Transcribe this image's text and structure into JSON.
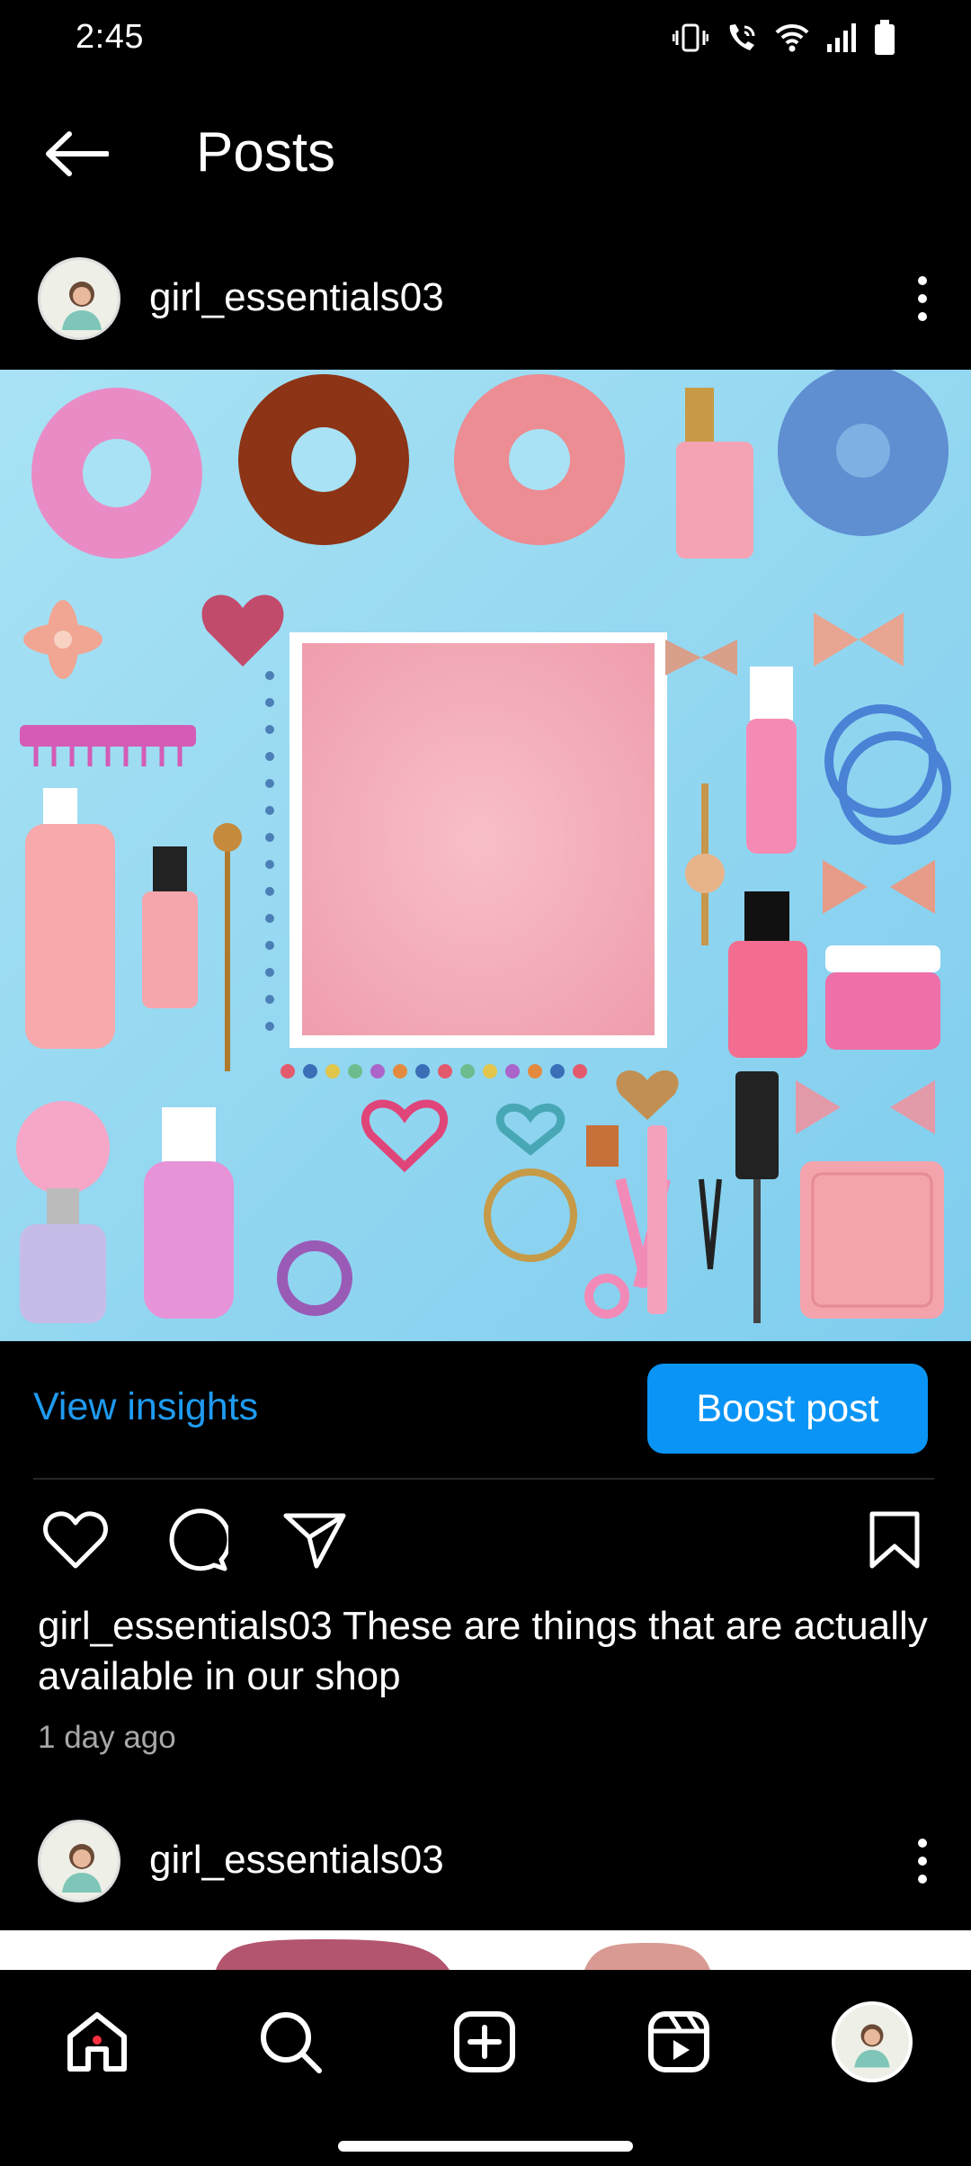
{
  "status_bar": {
    "time": "2:45",
    "icons": [
      "vibrate-icon",
      "wifi-call-icon",
      "wifi-icon",
      "signal-icon",
      "battery-icon"
    ]
  },
  "header": {
    "title": "Posts",
    "back_icon": "arrow-left-icon"
  },
  "post": {
    "username": "girl_essentials03",
    "image_description_icon": "post-photo",
    "view_insights_label": "View insights",
    "boost_label": "Boost post",
    "caption_user": "girl_essentials03",
    "caption_text": " These are things that are actually available in our shop",
    "timestamp": "1 day ago"
  },
  "next_post": {
    "username": "girl_essentials03"
  },
  "bottom_nav": {
    "items": [
      "home-icon",
      "search-icon",
      "create-icon",
      "reels-icon",
      "profile-avatar"
    ]
  },
  "colors": {
    "accent_blue": "#0a95f6",
    "link_blue": "#1f9bf0",
    "notification_dot": "#ff3040",
    "background": "#000000"
  }
}
